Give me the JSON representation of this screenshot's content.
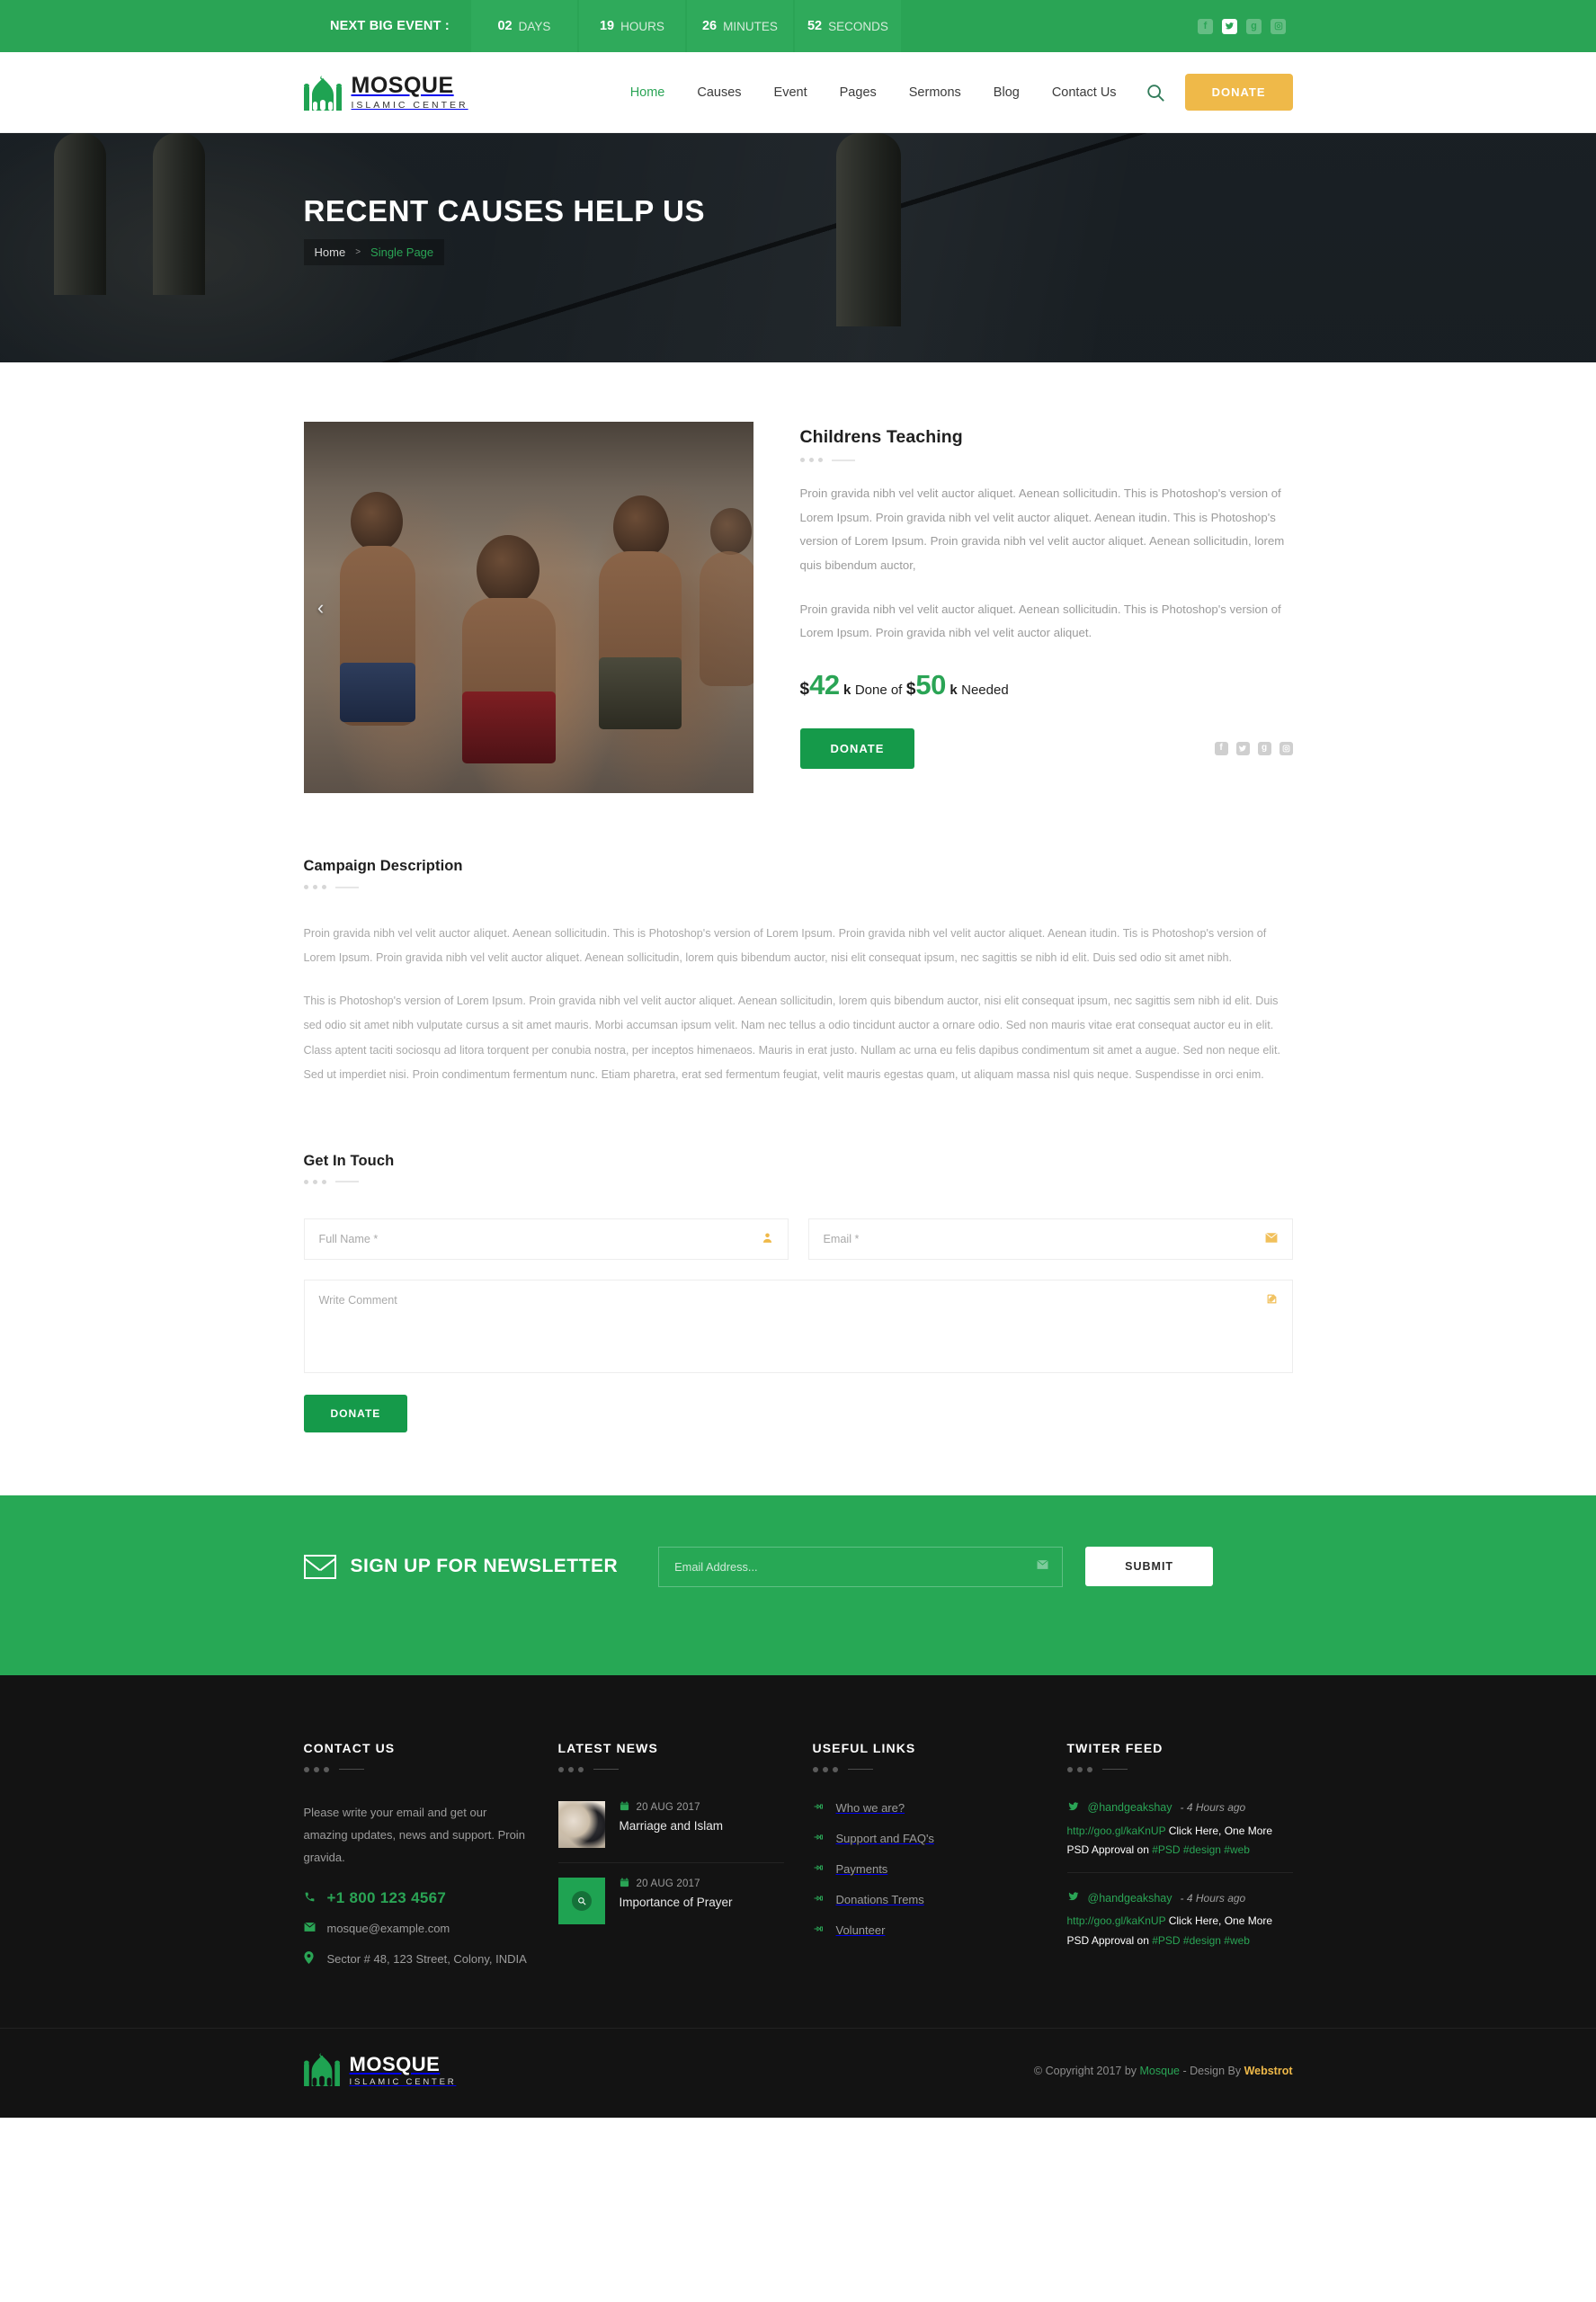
{
  "topbar": {
    "label": "NEXT BIG EVENT :",
    "countdown": [
      {
        "value": "02",
        "unit": "DAYS"
      },
      {
        "value": "19",
        "unit": "HOURS"
      },
      {
        "value": "26",
        "unit": "MINUTES"
      },
      {
        "value": "52",
        "unit": "SECONDS"
      }
    ],
    "social": [
      {
        "icon": "facebook-icon",
        "glyph": "f",
        "active": false
      },
      {
        "icon": "twitter-icon",
        "glyph": "t",
        "active": true
      },
      {
        "icon": "google-plus-icon",
        "glyph": "g",
        "active": false
      },
      {
        "icon": "instagram-icon",
        "glyph": "□",
        "active": false
      }
    ]
  },
  "header": {
    "brand": {
      "name": "MOSQUE",
      "tagline": "ISLAMIC CENTER"
    },
    "nav": [
      {
        "label": "Home",
        "active": true
      },
      {
        "label": "Causes",
        "active": false
      },
      {
        "label": "Event",
        "active": false
      },
      {
        "label": "Pages",
        "active": false
      },
      {
        "label": "Sermons",
        "active": false
      },
      {
        "label": "Blog",
        "active": false
      },
      {
        "label": "Contact Us",
        "active": false
      }
    ],
    "search_icon": "search-icon",
    "donate_label": "DONATE",
    "donate_color": "#efb949"
  },
  "banner": {
    "title": "RECENT CAUSES HELP US",
    "breadcrumb": {
      "home": "Home",
      "separator": ">",
      "current": "Single Page"
    }
  },
  "cause": {
    "title": "Childrens Teaching",
    "paragraphs": [
      "Proin gravida nibh vel velit auctor aliquet. Aenean sollicitudin. This is Photoshop's version  of Lorem Ipsum. Proin gravida nibh vel velit auctor aliquet. Aenean itudin. This is Photoshop's version  of Lorem Ipsum. Proin gravida nibh vel velit auctor aliquet. Aenean sollicitudin, lorem quis bibendum auctor,",
      "Proin gravida nibh vel velit auctor aliquet. Aenean sollicitudin. This is Photoshop's version  of Lorem Ipsum. Proin gravida nibh vel velit auctor aliquet."
    ],
    "goal": {
      "currency": "$",
      "raised": "42",
      "raised_unit": "k",
      "mid_text": "Done of",
      "needed": "50",
      "needed_unit": "k",
      "needed_text": "Needed"
    },
    "donate_label": "DONATE",
    "share": [
      {
        "icon": "facebook-icon",
        "glyph": "f"
      },
      {
        "icon": "twitter-icon",
        "glyph": "t"
      },
      {
        "icon": "google-plus-icon",
        "glyph": "g"
      },
      {
        "icon": "instagram-icon",
        "glyph": "□"
      }
    ],
    "prev_arrow": "‹"
  },
  "description": {
    "heading": "Campaign Description",
    "paragraphs": [
      "Proin gravida nibh vel velit auctor aliquet. Aenean sollicitudin. This is Photoshop's version  of Lorem Ipsum. Proin gravida nibh vel velit auctor aliquet. Aenean itudin. Tis is Photoshop's version  of Lorem Ipsum. Proin gravida nibh vel velit auctor aliquet. Aenean sollicitudin, lorem quis bibendum auctor, nisi elit consequat ipsum, nec sagittis se nibh id elit. Duis sed odio sit amet nibh.",
      "This is Photoshop's version  of Lorem Ipsum. Proin gravida nibh vel velit auctor aliquet. Aenean sollicitudin, lorem quis bibendum auctor, nisi elit consequat ipsum, nec sagittis sem nibh id elit. Duis sed odio sit amet nibh vulputate cursus a sit amet mauris. Morbi accumsan ipsum velit. Nam nec tellus a odio tincidunt auctor a ornare odio. Sed non  mauris vitae erat consequat auctor eu in elit. Class aptent taciti sociosqu ad litora torquent per conubia nostra, per inceptos himenaeos. Mauris in erat justo. Nullam ac urna eu felis dapibus condimentum sit amet a augue. Sed non neque elit. Sed ut imperdiet nisi. Proin condimentum fermentum nunc. Etiam pharetra, erat sed fermentum feugiat, velit mauris egestas quam, ut aliquam massa nisl quis neque. Suspendisse in orci enim."
    ]
  },
  "contact_form": {
    "heading": "Get In Touch",
    "fullname_placeholder": "Full Name *",
    "fullname_value": "",
    "fullname_icon": "user-icon",
    "email_placeholder": "Email *",
    "email_value": "",
    "email_icon": "envelope-icon",
    "comment_placeholder": "Write Comment",
    "comment_value": "",
    "comment_icon": "pencil-icon",
    "submit_label": "DONATE"
  },
  "newsletter": {
    "icon": "envelope-icon",
    "title": "SIGN UP FOR NEWSLETTER",
    "input_placeholder": "Email Address...",
    "input_value": "",
    "input_icon": "envelope-icon",
    "submit_label": "SUBMIT",
    "bg_color": "#27a855"
  },
  "footer": {
    "contact": {
      "heading": "CONTACT US",
      "about": "Please write your email and get our amazing updates, news and support. Proin gravida.",
      "phone": "+1 800 123 4567",
      "phone_icon": "phone-icon",
      "email": "mosque@example.com",
      "email_icon": "envelope-icon",
      "address": "Sector # 48, 123 Street, Colony, INDIA",
      "address_icon": "map-marker-icon"
    },
    "news": {
      "heading": "LATEST NEWS",
      "items": [
        {
          "date": "20 AUG 2017",
          "title": "Marriage and Islam",
          "thumb": "wedding-photo",
          "hover": false
        },
        {
          "date": "20 AUG 2017",
          "title": "Importance of Prayer",
          "thumb": "prayer-photo",
          "hover": true,
          "hover_icon": "magnifier-icon"
        }
      ]
    },
    "links": {
      "heading": "USEFUL LINKS",
      "icon": "hand-pointer-icon",
      "items": [
        "Who we are?",
        "Support and FAQ's",
        "Payments",
        "Donations Trems",
        "Volunteer"
      ]
    },
    "twitter": {
      "heading": "TWITER FEED",
      "icon": "twitter-icon",
      "items": [
        {
          "user": "@handgeakshay",
          "time": "- 4 Hours ago",
          "link": "http://goo.gl/kaKnUP",
          "text": "Click Here, One More PSD Approval on",
          "tags": "#PSD #design #web"
        },
        {
          "user": "@handgeakshay",
          "time": "- 4 Hours ago",
          "link": "http://goo.gl/kaKnUP",
          "text": "Click Here, One More PSD Approval on",
          "tags": "#PSD #design #web"
        }
      ]
    },
    "bottom": {
      "brand_name": "MOSQUE",
      "brand_tagline": "ISLAMIC CENTER",
      "copyright_prefix": "© Copyright 2017 by ",
      "copyright_brand": "Mosque",
      "copyright_mid": " -  Design By ",
      "copyright_author": "Webstrot"
    }
  },
  "colors": {
    "green": "#2aa455",
    "dark_green": "#159a4a",
    "amber": "#efb949",
    "footer_bg": "#131313"
  }
}
